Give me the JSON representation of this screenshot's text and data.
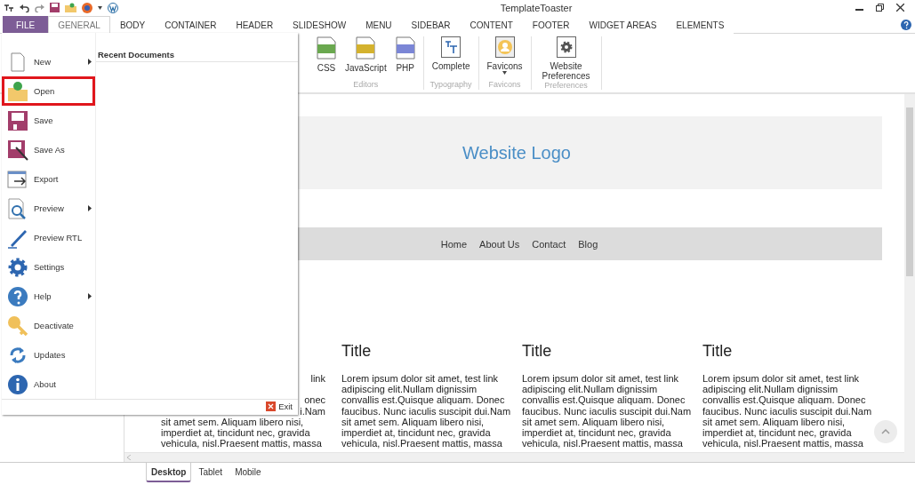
{
  "window": {
    "title": "TemplateToaster"
  },
  "tabs": [
    {
      "label": "FILE",
      "kind": "file",
      "selected": false
    },
    {
      "label": "GENERAL",
      "kind": "tab",
      "selected": true
    },
    {
      "label": "BODY",
      "kind": "tab",
      "selected": false
    },
    {
      "label": "CONTAINER",
      "kind": "tab",
      "selected": false
    },
    {
      "label": "HEADER",
      "kind": "tab",
      "selected": false
    },
    {
      "label": "SLIDESHOW",
      "kind": "tab",
      "selected": false
    },
    {
      "label": "MENU",
      "kind": "tab",
      "selected": false
    },
    {
      "label": "SIDEBAR",
      "kind": "tab",
      "selected": false
    },
    {
      "label": "CONTENT",
      "kind": "tab",
      "selected": false
    },
    {
      "label": "FOOTER",
      "kind": "tab",
      "selected": false
    },
    {
      "label": "WIDGET AREAS",
      "kind": "tab",
      "selected": false
    },
    {
      "label": "ELEMENTS",
      "kind": "tab",
      "selected": false
    }
  ],
  "ribbon": {
    "groups": [
      {
        "label": "Editors",
        "buttons": [
          {
            "label": "CSS",
            "kind": "css"
          },
          {
            "label": "JavaScript",
            "kind": "js"
          },
          {
            "label": "PHP",
            "kind": "php"
          }
        ]
      },
      {
        "label": "Typography",
        "buttons": [
          {
            "label": "Complete",
            "kind": "typography"
          }
        ]
      },
      {
        "label": "Favicons",
        "buttons": [
          {
            "label": "Favicons",
            "kind": "favicon",
            "dropdown": true
          }
        ]
      },
      {
        "label": "Preferences",
        "buttons": [
          {
            "label": "Website Preferences",
            "kind": "gear"
          }
        ]
      }
    ]
  },
  "file_menu": {
    "items": [
      {
        "label": "New",
        "kind": "new",
        "submenu": true,
        "selected": false
      },
      {
        "label": "Open",
        "kind": "open",
        "submenu": false,
        "selected": true
      },
      {
        "label": "Save",
        "kind": "save",
        "submenu": false,
        "selected": false
      },
      {
        "label": "Save As",
        "kind": "saveas",
        "submenu": false,
        "selected": false
      },
      {
        "label": "Export",
        "kind": "export",
        "submenu": false,
        "selected": false
      },
      {
        "label": "Preview",
        "kind": "preview",
        "submenu": true,
        "selected": false
      },
      {
        "label": "Preview RTL",
        "kind": "pen",
        "submenu": false,
        "selected": false
      },
      {
        "label": "Settings",
        "kind": "settings",
        "submenu": false,
        "selected": false
      },
      {
        "label": "Help",
        "kind": "help",
        "submenu": true,
        "selected": false
      },
      {
        "label": "Deactivate",
        "kind": "key",
        "submenu": false,
        "selected": false
      },
      {
        "label": "Updates",
        "kind": "updates",
        "submenu": false,
        "selected": false
      },
      {
        "label": "About",
        "kind": "about",
        "submenu": false,
        "selected": false
      }
    ],
    "recent_title": "Recent Documents",
    "exit": "Exit"
  },
  "preview": {
    "logo": "Website Logo",
    "nav": [
      "Home",
      "About Us",
      "Contact",
      "Blog"
    ],
    "columns": [
      {
        "lines": [
          {
            "kind": "fragment",
            "text": "link"
          },
          {
            "kind": "covered"
          },
          {
            "kind": "fragment",
            "text": "onec"
          },
          {
            "kind": "fragment",
            "text": "i.Nam"
          },
          {
            "kind": "line",
            "text": "sit amet sem. Aliquam libero nisi,"
          },
          {
            "kind": "line",
            "text": "imperdiet at, tincidunt nec, gravida"
          },
          {
            "kind": "line",
            "text": "vehicula, nisl.Praesent mattis, massa"
          }
        ]
      },
      {
        "title": "Title",
        "lines": [
          {
            "kind": "line",
            "text": "Lorem ipsum dolor sit amet, test link"
          },
          {
            "kind": "line",
            "text": "adipiscing elit.Nullam dignissim"
          },
          {
            "kind": "line",
            "text": "convallis est.Quisque aliquam. Donec"
          },
          {
            "kind": "line",
            "text": "faucibus. Nunc iaculis suscipit dui.Nam"
          },
          {
            "kind": "line",
            "text": "sit amet sem. Aliquam libero nisi,"
          },
          {
            "kind": "line",
            "text": "imperdiet at, tincidunt nec, gravida"
          },
          {
            "kind": "line",
            "text": "vehicula, nisl.Praesent mattis, massa"
          }
        ]
      },
      {
        "title": "Title",
        "lines": [
          {
            "kind": "line",
            "text": "Lorem ipsum dolor sit amet, test link"
          },
          {
            "kind": "line",
            "text": "adipiscing elit.Nullam dignissim"
          },
          {
            "kind": "line",
            "text": "convallis est.Quisque aliquam. Donec"
          },
          {
            "kind": "line",
            "text": "faucibus. Nunc iaculis suscipit dui.Nam"
          },
          {
            "kind": "line",
            "text": "sit amet sem. Aliquam libero nisi,"
          },
          {
            "kind": "line",
            "text": "imperdiet at, tincidunt nec, gravida"
          },
          {
            "kind": "line",
            "text": "vehicula, nisl.Praesent mattis, massa"
          }
        ]
      },
      {
        "title": "Title",
        "lines": [
          {
            "kind": "line",
            "text": "Lorem ipsum dolor sit amet, test link"
          },
          {
            "kind": "line",
            "text": "adipiscing elit.Nullam dignissim"
          },
          {
            "kind": "line",
            "text": "convallis est.Quisque aliquam. Donec"
          },
          {
            "kind": "line",
            "text": "faucibus. Nunc iaculis suscipit dui.Nam"
          },
          {
            "kind": "line",
            "text": "sit amet sem. Aliquam libero nisi,"
          },
          {
            "kind": "line",
            "text": "imperdiet at, tincidunt nec, gravida"
          },
          {
            "kind": "line",
            "text": "vehicula, nisl.Praesent mattis, massa"
          }
        ]
      }
    ]
  },
  "view_tabs": [
    {
      "label": "Desktop",
      "selected": true
    },
    {
      "label": "Tablet",
      "selected": false
    },
    {
      "label": "Mobile",
      "selected": false
    }
  ]
}
